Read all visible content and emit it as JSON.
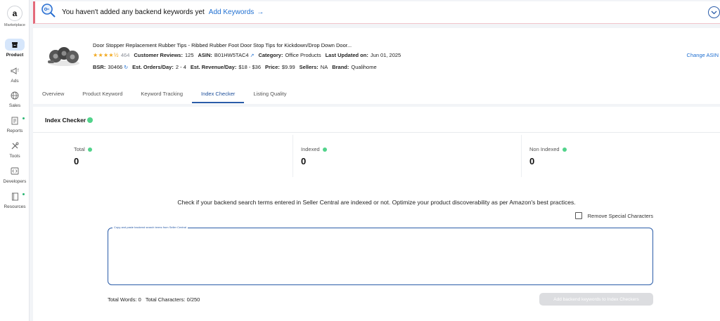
{
  "sidebar": {
    "logo": "a",
    "logo_label": "Marketplace",
    "items": [
      {
        "label": "Product",
        "icon": "archive-box-icon",
        "active": true
      },
      {
        "label": "Ads",
        "icon": "megaphone-icon"
      },
      {
        "label": "Sales",
        "icon": "globe-icon"
      },
      {
        "label": "Reports",
        "icon": "report-icon"
      },
      {
        "label": "Tools",
        "icon": "tools-icon"
      },
      {
        "label": "Developers",
        "icon": "code-icon"
      },
      {
        "label": "Resources",
        "icon": "book-icon"
      }
    ]
  },
  "alert": {
    "text": "You haven't added any backend keywords yet",
    "link": "Add Keywords",
    "arrow": "→"
  },
  "product": {
    "title": "Door Stopper Replacement Rubber Tips - Ribbed Rubber Foot Door Stop Tips for Kickdown/Drop Down Door...",
    "stars": "★★★★½",
    "rating_count": "464",
    "reviews_label": "Customer Reviews:",
    "reviews_value": "125",
    "asin_label": "ASIN:",
    "asin_value": "B01HW5TAC4",
    "category_label": "Category:",
    "category_value": "Office Products",
    "updated_label": "Last Updated on:",
    "updated_value": "Jun 01, 2025",
    "bsr_label": "BSR:",
    "bsr_value": "30466",
    "orders_label": "Est. Orders/Day:",
    "orders_value": "2 - 4",
    "revenue_label": "Est. Revenue/Day:",
    "revenue_value": "$18 - $36",
    "price_label": "Price:",
    "price_value": "$9.99",
    "sellers_label": "Sellers:",
    "sellers_value": "NA",
    "brand_label": "Brand:",
    "brand_value": "Qualihome",
    "change_asin": "Change ASIN"
  },
  "tabs": [
    {
      "label": "Overview"
    },
    {
      "label": "Product Keyword"
    },
    {
      "label": "Keyword Tracking"
    },
    {
      "label": "Index Checker",
      "active": true
    },
    {
      "label": "Listing Quality"
    }
  ],
  "index_checker": {
    "title": "Index Checker",
    "stats": [
      {
        "label": "Total",
        "value": "0"
      },
      {
        "label": "Indexed",
        "value": "0"
      },
      {
        "label": "Non Indexed",
        "value": "0"
      }
    ],
    "description": "Check if your backend search terms entered in Seller Central are indexed or not. Optimize your product discoverability as per Amazon's best practices.",
    "remove_special": "Remove Special Characters",
    "textarea_label": "Copy and paste backend search terms from Seller Central",
    "textarea_value": "",
    "total_words": "Total Words: 0",
    "total_chars": "Total Characters: 0/250",
    "add_button": "Add backend keywords to Index Checkers"
  },
  "colors": {
    "accent": "#2a5ca8",
    "link": "#1f6fd1",
    "alert_border": "#e46a7a",
    "success": "#52d38b",
    "star": "#f2a91f"
  }
}
